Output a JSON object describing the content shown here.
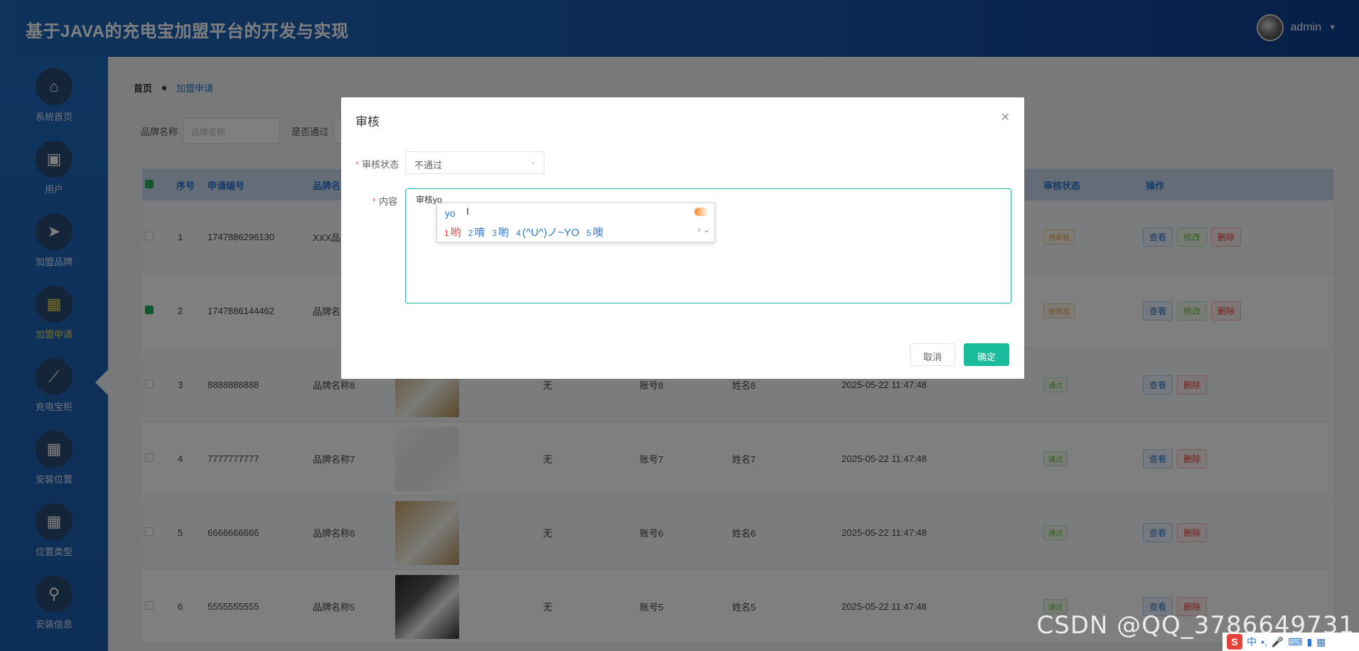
{
  "header": {
    "title": "基于JAVA的充电宝加盟平台的开发与实现",
    "username": "admin"
  },
  "sidebar": {
    "items": [
      {
        "label": "系统首页",
        "icon": "home-icon",
        "glyph": "⌂"
      },
      {
        "label": "用户",
        "icon": "user-list-icon",
        "glyph": "▣"
      },
      {
        "label": "加盟品牌",
        "icon": "paper-plane-icon",
        "glyph": "➤"
      },
      {
        "label": "加盟申请",
        "icon": "grid-icon",
        "glyph": "▦"
      },
      {
        "label": "充电宝柜",
        "icon": "chart-icon",
        "glyph": "⟋"
      },
      {
        "label": "安装位置",
        "icon": "grid-icon",
        "glyph": "▦"
      },
      {
        "label": "位置类型",
        "icon": "grid-icon",
        "glyph": "▦"
      },
      {
        "label": "安装信息",
        "icon": "stamp-icon",
        "glyph": "⚲"
      }
    ],
    "active_index": 3
  },
  "breadcrumb": {
    "home": "首页",
    "current": "加盟申请"
  },
  "filters": {
    "brand_label": "品牌名称",
    "brand_placeholder": "品牌名称",
    "passed_label": "是否通过"
  },
  "table": {
    "headers": {
      "index": "序号",
      "app_no": "申请编号",
      "brand": "品牌名",
      "status": "审核状态",
      "actions": "操作"
    },
    "rows": [
      {
        "index": "1",
        "app_no": "1747886296130",
        "brand": "XXX品",
        "reply": "",
        "account": "",
        "name": "",
        "time": "",
        "status": "待审核",
        "checked": false,
        "actions": [
          "查看",
          "修改",
          "删除"
        ]
      },
      {
        "index": "2",
        "app_no": "1747886144462",
        "brand": "品牌名",
        "reply": "",
        "account": "",
        "name": "",
        "time": "",
        "status": "待审核",
        "checked": true,
        "actions": [
          "查看",
          "修改",
          "删除"
        ]
      },
      {
        "index": "3",
        "app_no": "8888888888",
        "brand": "品牌名称8",
        "reply": "无",
        "account": "账号8",
        "name": "姓名8",
        "time": "2025-05-22 11:47:48",
        "status": "通过",
        "checked": false,
        "actions": [
          "查看",
          "删除"
        ]
      },
      {
        "index": "4",
        "app_no": "7777777777",
        "brand": "品牌名称7",
        "reply": "无",
        "account": "账号7",
        "name": "姓名7",
        "time": "2025-05-22 11:47:48",
        "status": "通过",
        "checked": false,
        "actions": [
          "查看",
          "删除"
        ]
      },
      {
        "index": "5",
        "app_no": "6666666666",
        "brand": "品牌名称6",
        "reply": "无",
        "account": "账号6",
        "name": "姓名6",
        "time": "2025-05-22 11:47:48",
        "status": "通过",
        "checked": false,
        "actions": [
          "查看",
          "删除"
        ]
      },
      {
        "index": "6",
        "app_no": "5555555555",
        "brand": "品牌名称5",
        "reply": "无",
        "account": "账号5",
        "name": "姓名5",
        "time": "2025-05-22 11:47:48",
        "status": "通过",
        "checked": false,
        "actions": [
          "查看",
          "删除"
        ]
      }
    ]
  },
  "dialog": {
    "title": "审核",
    "status_label": "审核状态",
    "status_value": "不通过",
    "content_label": "内容",
    "content_value": "审核yo",
    "cancel": "取消",
    "confirm": "确定"
  },
  "ime": {
    "typed": "yo",
    "candidates": [
      {
        "num": "1",
        "text": "哟"
      },
      {
        "num": "2",
        "text": "唷"
      },
      {
        "num": "3",
        "text": "喲"
      },
      {
        "num": "4",
        "text": "(^U^)ノ~YO"
      },
      {
        "num": "5",
        "text": "噢"
      }
    ]
  },
  "watermark": "CSDN @QQ_3786649731",
  "tray": {
    "ime_mode": "中",
    "icons": [
      "sogou-icon",
      "lang-icon",
      "punct-icon",
      "mic-icon",
      "keyboard-icon",
      "skin-icon",
      "toolbox-icon"
    ]
  }
}
